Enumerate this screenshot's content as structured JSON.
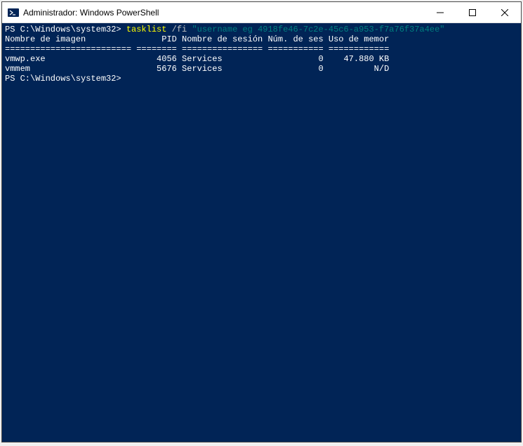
{
  "window": {
    "title": "Administrador: Windows PowerShell"
  },
  "terminal": {
    "prompt1_path": "PS C:\\Windows\\system32> ",
    "prompt1_cmd": "tasklist ",
    "prompt1_arg": "/fi ",
    "prompt1_filter": "\"username eg 4918fe46-7c2e-45c6-a953-f7a76f37a4ee\"",
    "blank": "",
    "header": "Nombre de imagen               PID Nombre de sesión Núm. de ses Uso de memor",
    "divider": "========================= ======== ================ =========== ============",
    "row1": "vmwp.exe                      4056 Services                   0    47.880 KB",
    "row2": "vmmem                         5676 Services                   0          N/D",
    "prompt2_path": "PS C:\\Windows\\system32> "
  }
}
